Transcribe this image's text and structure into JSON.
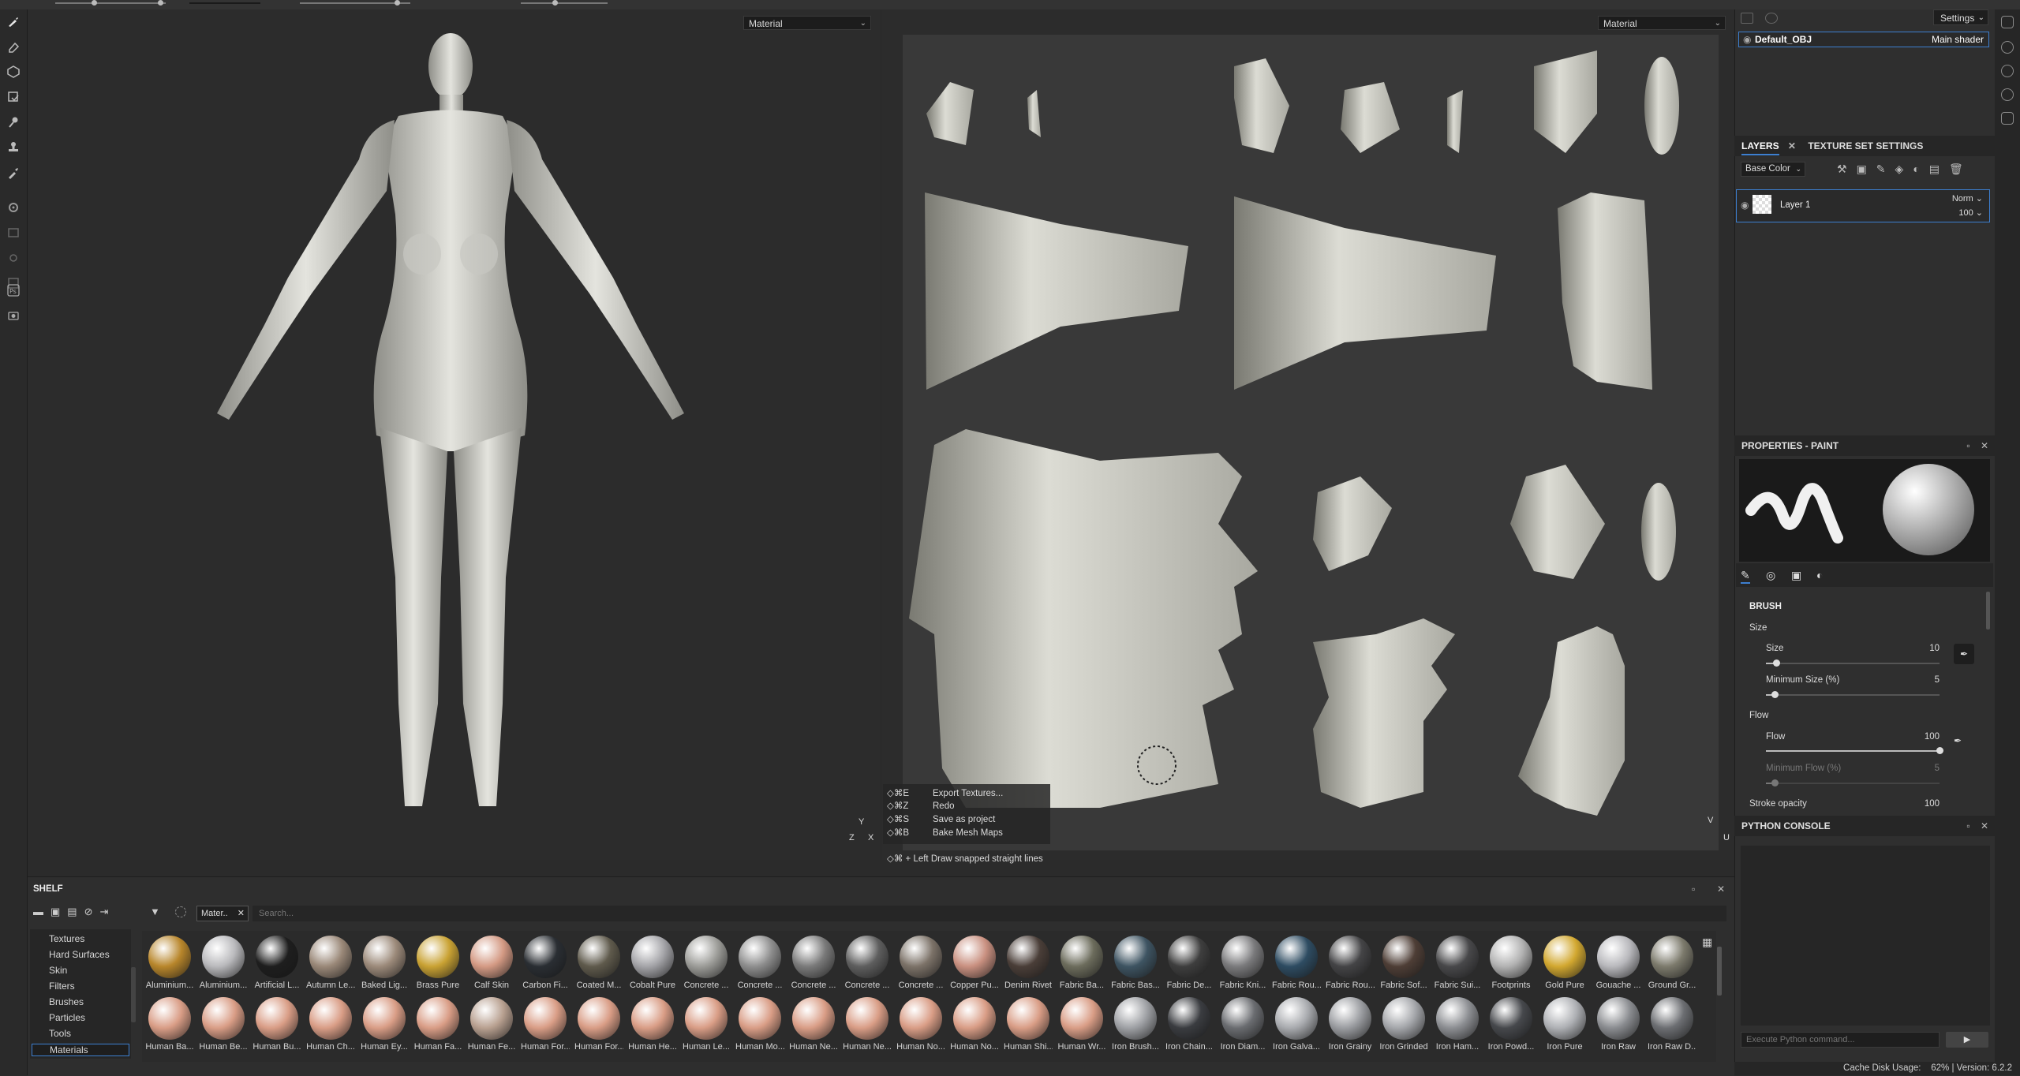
{
  "viewport_3d": {
    "mode": "Material"
  },
  "viewport_uv": {
    "mode": "Material"
  },
  "shortcuts": [
    {
      "keys": "◇⌘E",
      "action": "Export Textures..."
    },
    {
      "keys": "◇⌘Z",
      "action": "Redo"
    },
    {
      "keys": "◇⌘S",
      "action": "Save as project"
    },
    {
      "keys": "◇⌘B",
      "action": "Bake Mesh Maps"
    }
  ],
  "hint": "◇⌘ + Left  Draw snapped straight lines",
  "axis": {
    "x": "X",
    "y": "Y",
    "z": "Z",
    "u": "U",
    "v": "V"
  },
  "texture_set": {
    "settings_label": "Settings",
    "name": "Default_OBJ",
    "shader": "Main shader"
  },
  "layers": {
    "tab_layers": "LAYERS",
    "tab_texture_set": "TEXTURE SET SETTINGS",
    "channel": "Base Color",
    "items": [
      {
        "name": "Layer 1",
        "blend": "Norm",
        "opacity": "100"
      }
    ]
  },
  "properties": {
    "title": "PROPERTIES - PAINT",
    "section_brush": "BRUSH",
    "size_group": "Size",
    "size_label": "Size",
    "size_value": "10",
    "size_fraction": 0.06,
    "min_size_label": "Minimum Size (%)",
    "min_size_value": "5",
    "min_size_fraction": 0.05,
    "flow_group": "Flow",
    "flow_label": "Flow",
    "flow_value": "100",
    "flow_fraction": 1.0,
    "min_flow_label": "Minimum Flow (%)",
    "min_flow_value": "5",
    "min_flow_fraction": 0.05,
    "stroke_label": "Stroke opacity",
    "stroke_value": "100"
  },
  "python_console": {
    "title": "PYTHON CONSOLE",
    "placeholder": "Execute Python command..."
  },
  "shelf": {
    "title": "SHELF",
    "tab": "Mater..",
    "search_placeholder": "Search...",
    "categories": [
      "Textures",
      "Hard Surfaces",
      "Skin",
      "Filters",
      "Brushes",
      "Particles",
      "Tools",
      "Materials"
    ],
    "selected_category": "Materials",
    "row1": [
      {
        "label": "Aluminium...",
        "color": "#b8862b"
      },
      {
        "label": "Aluminium...",
        "color": "#b9b9bc"
      },
      {
        "label": "Artificial L...",
        "color": "#1e1e1e"
      },
      {
        "label": "Autumn Le...",
        "color": "#9a8878"
      },
      {
        "label": "Baked Lig...",
        "color": "#9c8a7a"
      },
      {
        "label": "Brass Pure",
        "color": "#c9a233"
      },
      {
        "label": "Calf Skin",
        "color": "#d49a84"
      },
      {
        "label": "Carbon Fi...",
        "color": "#2a2e33"
      },
      {
        "label": "Coated M...",
        "color": "#5f5a4c"
      },
      {
        "label": "Cobalt Pure",
        "color": "#a4a4a8"
      },
      {
        "label": "Concrete ...",
        "color": "#9c9c98"
      },
      {
        "label": "Concrete ...",
        "color": "#8e8e8e"
      },
      {
        "label": "Concrete ...",
        "color": "#7a7a7a"
      },
      {
        "label": "Concrete ...",
        "color": "#5e5e5e"
      },
      {
        "label": "Concrete ...",
        "color": "#7c7268"
      },
      {
        "label": "Copper Pu...",
        "color": "#c99080"
      },
      {
        "label": "Denim Rivet",
        "color": "#4a3e38"
      },
      {
        "label": "Fabric Ba...",
        "color": "#6c6c5c"
      },
      {
        "label": "Fabric Bas...",
        "color": "#3e5462"
      },
      {
        "label": "Fabric De...",
        "color": "#3e3e3e"
      },
      {
        "label": "Fabric Kni...",
        "color": "#7a7a7c"
      },
      {
        "label": "Fabric Rou...",
        "color": "#2e4c62"
      },
      {
        "label": "Fabric Rou...",
        "color": "#444446"
      },
      {
        "label": "Fabric Sof...",
        "color": "#4e3e36"
      },
      {
        "label": "Fabric Sui...",
        "color": "#48484a"
      },
      {
        "label": "Footprints",
        "color": "#b2b2b2"
      },
      {
        "label": "Gold Pure",
        "color": "#d2a830"
      },
      {
        "label": "Gouache ...",
        "color": "#b8b8bc"
      },
      {
        "label": "Ground Gr...",
        "color": "#7c7a6c"
      }
    ],
    "row2": [
      {
        "label": "Human Ba...",
        "color": "#d99d86"
      },
      {
        "label": "Human Be...",
        "color": "#d99d86"
      },
      {
        "label": "Human Bu...",
        "color": "#d99d86"
      },
      {
        "label": "Human Ch...",
        "color": "#d99d86"
      },
      {
        "label": "Human Ey...",
        "color": "#d99d86"
      },
      {
        "label": "Human Fa...",
        "color": "#d99d86"
      },
      {
        "label": "Human Fe...",
        "color": "#b8a090"
      },
      {
        "label": "Human For...",
        "color": "#d99d86"
      },
      {
        "label": "Human For...",
        "color": "#d99d86"
      },
      {
        "label": "Human He...",
        "color": "#d99d86"
      },
      {
        "label": "Human Le...",
        "color": "#d99d86"
      },
      {
        "label": "Human Mo...",
        "color": "#d99d86"
      },
      {
        "label": "Human Ne...",
        "color": "#d99d86"
      },
      {
        "label": "Human Ne...",
        "color": "#d99d86"
      },
      {
        "label": "Human No...",
        "color": "#d99d86"
      },
      {
        "label": "Human No...",
        "color": "#d99d86"
      },
      {
        "label": "Human Shi...",
        "color": "#d99d86"
      },
      {
        "label": "Human Wr...",
        "color": "#d99d86"
      },
      {
        "label": "Iron Brush...",
        "color": "#9ea0a4"
      },
      {
        "label": "Iron Chain...",
        "color": "#3a3c40"
      },
      {
        "label": "Iron Diam...",
        "color": "#6a6c70"
      },
      {
        "label": "Iron Galva...",
        "color": "#a8aaae"
      },
      {
        "label": "Iron Grainy",
        "color": "#9a9ca0"
      },
      {
        "label": "Iron Grinded",
        "color": "#a4a6aa"
      },
      {
        "label": "Iron Ham...",
        "color": "#8c8e92"
      },
      {
        "label": "Iron Powd...",
        "color": "#46484c"
      },
      {
        "label": "Iron Pure",
        "color": "#aeb0b4"
      },
      {
        "label": "Iron Raw",
        "color": "#8a8c90"
      },
      {
        "label": "Iron Raw D...",
        "color": "#6c6e72"
      }
    ]
  },
  "status": {
    "cache": "Cache Disk Usage:",
    "cache_value": "62%",
    "version": "Version: 6.2.2"
  }
}
